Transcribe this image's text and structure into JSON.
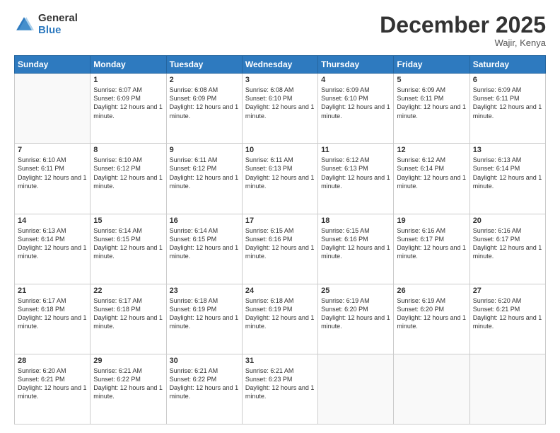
{
  "logo": {
    "general": "General",
    "blue": "Blue"
  },
  "header": {
    "month": "December 2025",
    "location": "Wajir, Kenya"
  },
  "weekdays": [
    "Sunday",
    "Monday",
    "Tuesday",
    "Wednesday",
    "Thursday",
    "Friday",
    "Saturday"
  ],
  "weeks": [
    [
      {
        "day": "",
        "info": ""
      },
      {
        "day": "1",
        "info": "Sunrise: 6:07 AM\nSunset: 6:09 PM\nDaylight: 12 hours and 1 minute."
      },
      {
        "day": "2",
        "info": "Sunrise: 6:08 AM\nSunset: 6:09 PM\nDaylight: 12 hours and 1 minute."
      },
      {
        "day": "3",
        "info": "Sunrise: 6:08 AM\nSunset: 6:10 PM\nDaylight: 12 hours and 1 minute."
      },
      {
        "day": "4",
        "info": "Sunrise: 6:09 AM\nSunset: 6:10 PM\nDaylight: 12 hours and 1 minute."
      },
      {
        "day": "5",
        "info": "Sunrise: 6:09 AM\nSunset: 6:11 PM\nDaylight: 12 hours and 1 minute."
      },
      {
        "day": "6",
        "info": "Sunrise: 6:09 AM\nSunset: 6:11 PM\nDaylight: 12 hours and 1 minute."
      }
    ],
    [
      {
        "day": "7",
        "info": "Sunrise: 6:10 AM\nSunset: 6:11 PM\nDaylight: 12 hours and 1 minute."
      },
      {
        "day": "8",
        "info": "Sunrise: 6:10 AM\nSunset: 6:12 PM\nDaylight: 12 hours and 1 minute."
      },
      {
        "day": "9",
        "info": "Sunrise: 6:11 AM\nSunset: 6:12 PM\nDaylight: 12 hours and 1 minute."
      },
      {
        "day": "10",
        "info": "Sunrise: 6:11 AM\nSunset: 6:13 PM\nDaylight: 12 hours and 1 minute."
      },
      {
        "day": "11",
        "info": "Sunrise: 6:12 AM\nSunset: 6:13 PM\nDaylight: 12 hours and 1 minute."
      },
      {
        "day": "12",
        "info": "Sunrise: 6:12 AM\nSunset: 6:14 PM\nDaylight: 12 hours and 1 minute."
      },
      {
        "day": "13",
        "info": "Sunrise: 6:13 AM\nSunset: 6:14 PM\nDaylight: 12 hours and 1 minute."
      }
    ],
    [
      {
        "day": "14",
        "info": "Sunrise: 6:13 AM\nSunset: 6:14 PM\nDaylight: 12 hours and 1 minute."
      },
      {
        "day": "15",
        "info": "Sunrise: 6:14 AM\nSunset: 6:15 PM\nDaylight: 12 hours and 1 minute."
      },
      {
        "day": "16",
        "info": "Sunrise: 6:14 AM\nSunset: 6:15 PM\nDaylight: 12 hours and 1 minute."
      },
      {
        "day": "17",
        "info": "Sunrise: 6:15 AM\nSunset: 6:16 PM\nDaylight: 12 hours and 1 minute."
      },
      {
        "day": "18",
        "info": "Sunrise: 6:15 AM\nSunset: 6:16 PM\nDaylight: 12 hours and 1 minute."
      },
      {
        "day": "19",
        "info": "Sunrise: 6:16 AM\nSunset: 6:17 PM\nDaylight: 12 hours and 1 minute."
      },
      {
        "day": "20",
        "info": "Sunrise: 6:16 AM\nSunset: 6:17 PM\nDaylight: 12 hours and 1 minute."
      }
    ],
    [
      {
        "day": "21",
        "info": "Sunrise: 6:17 AM\nSunset: 6:18 PM\nDaylight: 12 hours and 1 minute."
      },
      {
        "day": "22",
        "info": "Sunrise: 6:17 AM\nSunset: 6:18 PM\nDaylight: 12 hours and 1 minute."
      },
      {
        "day": "23",
        "info": "Sunrise: 6:18 AM\nSunset: 6:19 PM\nDaylight: 12 hours and 1 minute."
      },
      {
        "day": "24",
        "info": "Sunrise: 6:18 AM\nSunset: 6:19 PM\nDaylight: 12 hours and 1 minute."
      },
      {
        "day": "25",
        "info": "Sunrise: 6:19 AM\nSunset: 6:20 PM\nDaylight: 12 hours and 1 minute."
      },
      {
        "day": "26",
        "info": "Sunrise: 6:19 AM\nSunset: 6:20 PM\nDaylight: 12 hours and 1 minute."
      },
      {
        "day": "27",
        "info": "Sunrise: 6:20 AM\nSunset: 6:21 PM\nDaylight: 12 hours and 1 minute."
      }
    ],
    [
      {
        "day": "28",
        "info": "Sunrise: 6:20 AM\nSunset: 6:21 PM\nDaylight: 12 hours and 1 minute."
      },
      {
        "day": "29",
        "info": "Sunrise: 6:21 AM\nSunset: 6:22 PM\nDaylight: 12 hours and 1 minute."
      },
      {
        "day": "30",
        "info": "Sunrise: 6:21 AM\nSunset: 6:22 PM\nDaylight: 12 hours and 1 minute."
      },
      {
        "day": "31",
        "info": "Sunrise: 6:21 AM\nSunset: 6:23 PM\nDaylight: 12 hours and 1 minute."
      },
      {
        "day": "",
        "info": ""
      },
      {
        "day": "",
        "info": ""
      },
      {
        "day": "",
        "info": ""
      }
    ]
  ]
}
